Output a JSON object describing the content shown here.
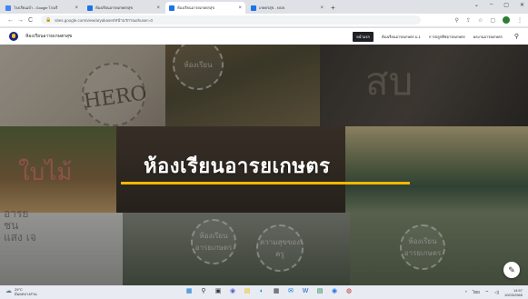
{
  "browser": {
    "tabs": [
      {
        "label": "โรงเรียนเบ้า - Google โรงเรี",
        "favicon_color": "#4285f4",
        "active": false
      },
      {
        "label": "ห้องเรียนอารยเกษตรสุข",
        "favicon_color": "#1a73e8",
        "active": false
      },
      {
        "label": "ห้องเรียนอารยเกษตรสุข",
        "favicon_color": "#1a73e8",
        "active": true
      },
      {
        "label": "เกษตรสุข - NGK",
        "favicon_color": "#1a73e8",
        "active": false
      }
    ],
    "new_tab": "+",
    "window_controls": [
      "⌄",
      "–",
      "▢",
      "✕"
    ],
    "address": "sites.google.com/view/aryakaset/หน้าแรก?authuser=0",
    "nav": {
      "back": "←",
      "forward": "→",
      "reload": "C",
      "lock": "🔒"
    },
    "toolbar_icons": [
      "⚲",
      "⇪",
      "☆",
      "▢"
    ]
  },
  "site": {
    "title": "ห้องเรียนอารยเกษตรสุข",
    "nav_items": [
      {
        "label": "หน้าแรก",
        "active": true
      },
      {
        "label": "ห้องเรียนอารยเกษตร ม.1",
        "active": false
      },
      {
        "label": "การปลูกพืชอารยเกษตร",
        "active": false
      },
      {
        "label": "ผลงานอารยเกษตร",
        "active": false
      }
    ],
    "search_icon": "⚲"
  },
  "hero": {
    "title": "ห้องเรียนอารยเกษตร",
    "decor_words": {
      "hero": "HERO",
      "bai": "ใบไม้",
      "sab": "สบ",
      "side": "อารย ชน แสง เจ"
    },
    "circle_labels": [
      "ห้องเรียน",
      "ห้องเรียนอารยเกษตร",
      "ความสุขของครู",
      "ห้องเรียนอารยเกษตร"
    ],
    "edit_icon": "✎",
    "accent": "#f2b705"
  },
  "taskbar": {
    "weather_temp": "29°C",
    "weather_desc": "มีแดดบางส่วน",
    "weather_icon": "☁",
    "icons": [
      {
        "name": "windows",
        "glyph": "▦",
        "color": "#0078d4"
      },
      {
        "name": "search",
        "glyph": "⚲",
        "color": "#333"
      },
      {
        "name": "taskview",
        "glyph": "▣",
        "color": "#333"
      },
      {
        "name": "chat",
        "glyph": "◉",
        "color": "#5b5fc7"
      },
      {
        "name": "explorer",
        "glyph": "▤",
        "color": "#f2b705"
      },
      {
        "name": "edge",
        "glyph": "◐",
        "color": "#0c8ce9"
      },
      {
        "name": "store",
        "glyph": "▦",
        "color": "#333"
      },
      {
        "name": "mail",
        "glyph": "✉",
        "color": "#0078d4"
      },
      {
        "name": "word",
        "glyph": "W",
        "color": "#185abd"
      },
      {
        "name": "excel",
        "glyph": "▤",
        "color": "#107c41"
      },
      {
        "name": "chrome",
        "glyph": "◉",
        "color": "#1a73e8"
      },
      {
        "name": "app",
        "glyph": "◍",
        "color": "#c62828"
      }
    ],
    "tray": {
      "chevron": "^",
      "ime": "ไทย",
      "wifi": "⌔",
      "volume": "◁)",
      "time": "14:57",
      "date": "10/03/2565"
    }
  }
}
